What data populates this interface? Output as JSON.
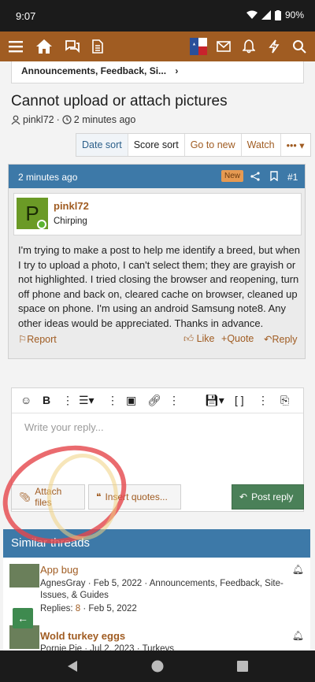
{
  "status": {
    "time": "9:07",
    "battery": "90%"
  },
  "nav": {
    "icons": [
      "menu-icon",
      "home-icon",
      "chat-icon",
      "document-icon",
      "flag-avatar-icon",
      "mail-icon",
      "bell-icon",
      "bolt-icon",
      "search-icon"
    ]
  },
  "breadcrumb": {
    "label": "Announcements, Feedback, Si...",
    "chevron": "›"
  },
  "thread": {
    "title": "Cannot upload or attach pictures",
    "author": "pinkl72",
    "time": "2 minutes ago"
  },
  "sort": {
    "date": "Date sort",
    "score": "Score sort",
    "goto": "Go to new",
    "watch": "Watch",
    "more": "•••"
  },
  "post": {
    "time": "2 minutes ago",
    "badge": "New",
    "number": "#1",
    "avatar_letter": "P",
    "username": "pinkl72",
    "role": "Chirping",
    "body": "I'm trying to make a post to help me identify a breed, but when I try to upload a photo, I can't select them; they are grayish or not highlighted. I tried closing the browser and reopening, turn off phone and back on, cleared cache on browser, cleaned up space on phone. I'm using an android Samsung note8. Any other ideas would be appreciated. Thanks in advance.",
    "report": "Report",
    "like": "Like",
    "quote": "Quote",
    "reply": "Reply"
  },
  "editor": {
    "placeholder": "Write your reply...",
    "attach": "Attach files",
    "insert_quotes": "Insert quotes...",
    "post_reply": "Post reply"
  },
  "similar": {
    "heading": "Similar threads",
    "threads": [
      {
        "title": "App bug",
        "author": "AgnesGray",
        "date": "Feb 5, 2022",
        "forum": "Announcements, Feedback, Site-Issues, & Guides",
        "replies_label": "Replies:",
        "replies": "8",
        "last": "Feb 5, 2022"
      },
      {
        "title": "Wold turkey eggs",
        "author": "Pornie Pie",
        "date": "Jul 2, 2023",
        "forum": "Turkeys"
      }
    ]
  },
  "colors": {
    "brand": "#a05c22",
    "header_blue": "#3d79a8",
    "post_green": "#4a8058",
    "annotation_red": "#e5464b"
  }
}
